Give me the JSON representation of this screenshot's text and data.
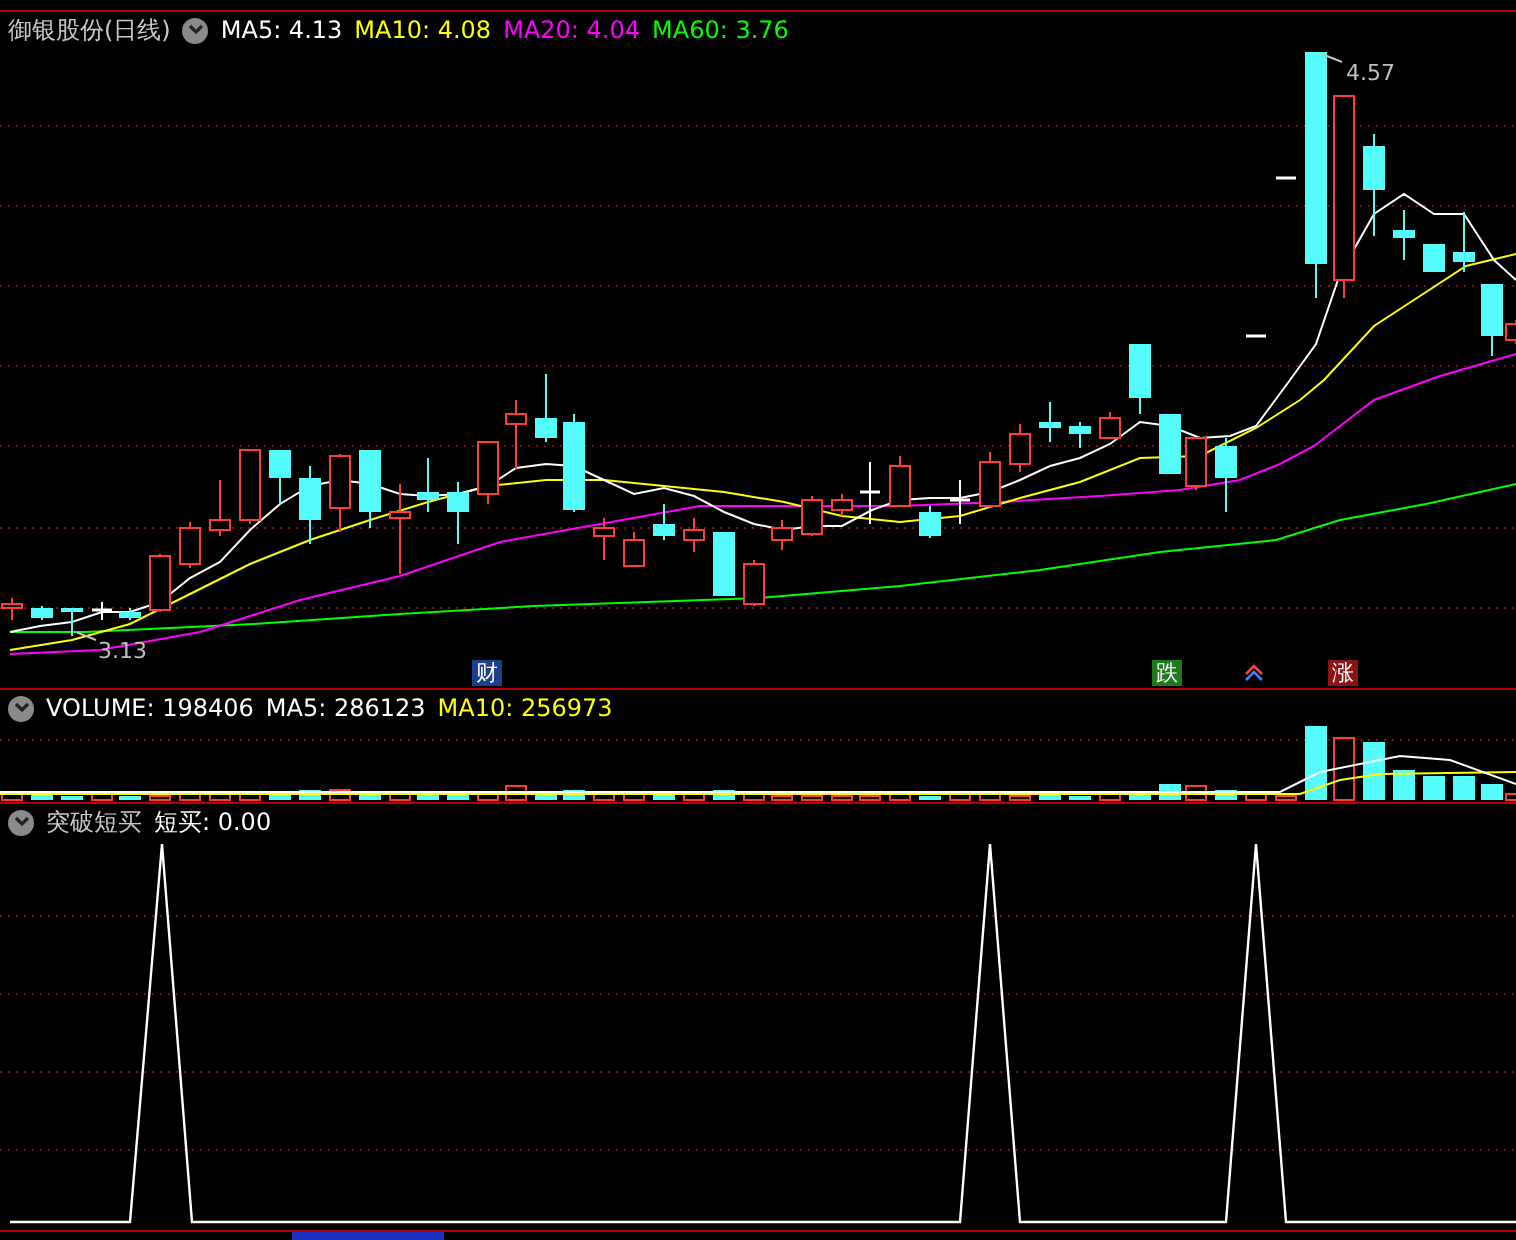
{
  "title": "御银股份(日线)",
  "ma_legend": [
    {
      "label": "MA5: 4.13",
      "color": "#ffffff"
    },
    {
      "label": "MA10: 4.08",
      "color": "#ffff00"
    },
    {
      "label": "MA20: 4.04",
      "color": "#ff00ff"
    },
    {
      "label": "MA60: 3.76",
      "color": "#00ff00"
    }
  ],
  "price_labels": [
    {
      "text": "4.57"
    },
    {
      "text": "3.13"
    }
  ],
  "event_markers": [
    {
      "label": "财",
      "color": "#1e3f8c"
    },
    {
      "label": "跌",
      "color": "#1d7a1d"
    },
    {
      "label": "涨",
      "color": "#8c1414"
    }
  ],
  "volume": {
    "legend": [
      {
        "label": "VOLUME: 198406",
        "color": "#ffffff"
      },
      {
        "label": "MA5: 286123",
        "color": "#ffffff"
      },
      {
        "label": "MA10: 256973",
        "color": "#ffff00"
      }
    ]
  },
  "indicator": {
    "title": "突破短买",
    "legend": [
      {
        "label": "短买: 0.00",
        "color": "#ffffff"
      }
    ]
  }
}
